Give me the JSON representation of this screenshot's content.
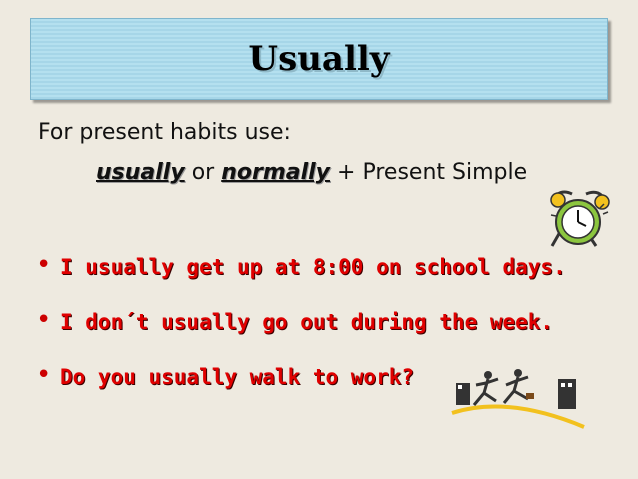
{
  "title": "Usually",
  "intro": "For present habits use:",
  "formula": {
    "keyword1": "usually",
    "joiner": "or",
    "keyword2": "normally",
    "plus": "+",
    "rest": "Present Simple"
  },
  "bullets": [
    "I usually get up at 8:00 on school days.",
    "I don´t usually go out during the week.",
    "Do you usually walk to work?"
  ],
  "bullet_symbol": "•",
  "colors": {
    "title_band": "#b4e0ef",
    "bullet_text": "#e00000",
    "background": "#eeeae0"
  },
  "icons": [
    "alarm-clock-icon",
    "running-businessman-icon"
  ]
}
